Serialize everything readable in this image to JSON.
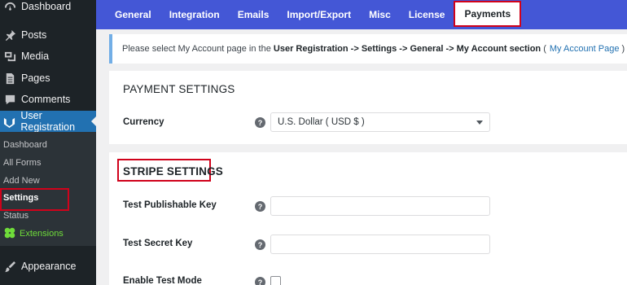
{
  "sidebar": {
    "menu": [
      {
        "label": "Dashboard",
        "icon": "dashboard-icon"
      },
      {
        "label": "Posts",
        "icon": "pin-icon"
      },
      {
        "label": "Media",
        "icon": "media-icon"
      },
      {
        "label": "Pages",
        "icon": "pages-icon"
      },
      {
        "label": "Comments",
        "icon": "comment-icon"
      },
      {
        "label": "User Registration",
        "icon": "user-registration-icon"
      },
      {
        "label": "Appearance",
        "icon": "appearance-icon"
      }
    ],
    "submenu": [
      "Dashboard",
      "All Forms",
      "Add New",
      "Settings",
      "Status"
    ],
    "extensions_label": "Extensions"
  },
  "tabs": [
    "General",
    "Integration",
    "Emails",
    "Import/Export",
    "Misc",
    "License",
    "Payments"
  ],
  "notice": {
    "prefix": "Please select My Account page in the",
    "path1": "User Registration",
    "sep": "->",
    "path2": "Settings",
    "path3": "General",
    "path4": "My Account section",
    "open_paren": "(",
    "link": "My Account Page",
    "close_paren": ")"
  },
  "payment_settings": {
    "title": "PAYMENT SETTINGS",
    "currency_label": "Currency",
    "currency_value": "U.S. Dollar ( USD $ )"
  },
  "stripe_settings": {
    "title": "STRIPE SETTINGS",
    "publishable_key_label": "Test Publishable Key",
    "secret_key_label": "Test Secret Key",
    "test_mode_label": "Enable Test Mode"
  },
  "colors": {
    "tab_bar": "#4457d6",
    "sidebar": "#1d2327",
    "active_menu": "#2271b1",
    "highlight": "#d0021b",
    "extensions": "#6fdc3a"
  }
}
